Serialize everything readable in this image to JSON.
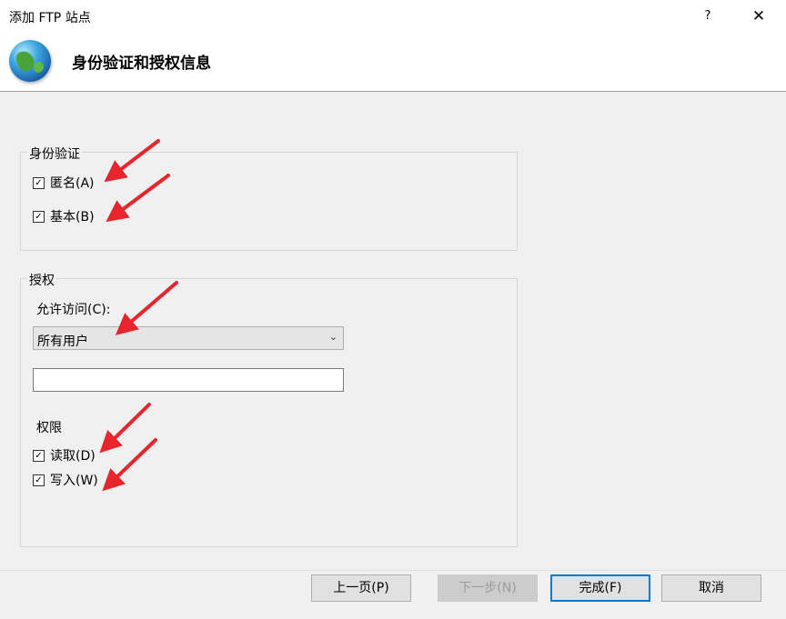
{
  "window": {
    "title": "添加 FTP 站点",
    "help_glyph": "?",
    "close_glyph": "✕"
  },
  "header": {
    "title": "身份验证和授权信息",
    "icon": "globe-icon"
  },
  "authentication": {
    "legend": "身份验证",
    "anonymous": {
      "label": "匿名(A)",
      "checked": true
    },
    "basic": {
      "label": "基本(B)",
      "checked": true
    }
  },
  "authorization": {
    "legend": "授权",
    "allow_access_label": "允许访问(C):",
    "allow_access_value": "所有用户",
    "users_field_value": "",
    "permissions_label": "权限",
    "read": {
      "label": "读取(D)",
      "checked": true
    },
    "write": {
      "label": "写入(W)",
      "checked": true
    }
  },
  "buttons": {
    "previous": "上一页(P)",
    "next": "下一步(N)",
    "finish": "完成(F)",
    "cancel": "取消"
  },
  "annotations": {
    "arrow_color": "#e8252c",
    "arrow_count": 5
  },
  "check_glyph": "✓"
}
